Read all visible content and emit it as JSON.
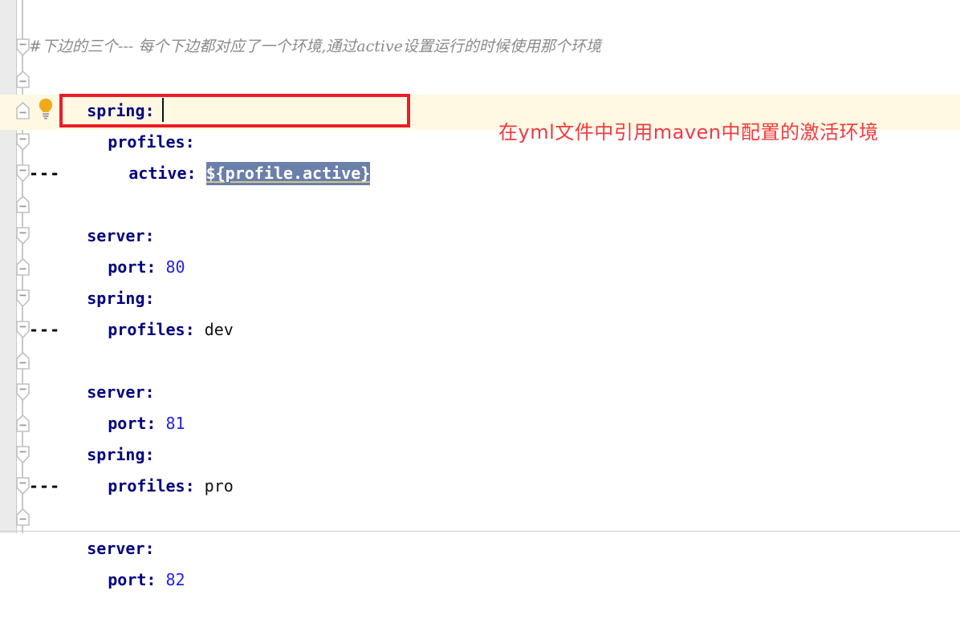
{
  "editor": {
    "app": "intellij-yaml-editor",
    "comment_line": "#下边的三个--- 每个下边都对应了一个环境,通过active设置运行的时候使用那个环境",
    "selection_background": "#6b7fab",
    "current_line_background": "#fff8e3",
    "key_color": "#000080",
    "number_color": "#2222ee",
    "comment_color": "#8a8a8a",
    "annotation_color": "#f23b3b",
    "red_box_color": "#ed1c24",
    "gutter_color": "#ebebeb"
  },
  "code": {
    "lines": [
      {
        "indent": 0,
        "key": "spring",
        "colon": ":",
        "value": "",
        "type": "key"
      },
      {
        "indent": 1,
        "key": "profiles",
        "colon": ":",
        "value": "",
        "type": "key"
      },
      {
        "indent": 2,
        "key": "active",
        "colon": ":",
        "value": "${profile.active}",
        "type": "selected"
      },
      {
        "indent": 0,
        "key": "",
        "colon": "",
        "value": "---",
        "type": "separator"
      },
      {
        "indent": 0,
        "key": "server",
        "colon": ":",
        "value": "",
        "type": "key"
      },
      {
        "indent": 1,
        "key": "port",
        "colon": ":",
        "value": "80",
        "type": "number"
      },
      {
        "indent": 0,
        "key": "spring",
        "colon": ":",
        "value": "",
        "type": "key"
      },
      {
        "indent": 1,
        "key": "profiles",
        "colon": ":",
        "value": "dev",
        "type": "string"
      },
      {
        "indent": 0,
        "key": "",
        "colon": "",
        "value": "---",
        "type": "separator"
      },
      {
        "indent": 0,
        "key": "server",
        "colon": ":",
        "value": "",
        "type": "key"
      },
      {
        "indent": 1,
        "key": "port",
        "colon": ":",
        "value": "81",
        "type": "number"
      },
      {
        "indent": 0,
        "key": "spring",
        "colon": ":",
        "value": "",
        "type": "key"
      },
      {
        "indent": 1,
        "key": "profiles",
        "colon": ":",
        "value": "pro",
        "type": "string"
      },
      {
        "indent": 0,
        "key": "",
        "colon": "",
        "value": "---",
        "type": "separator"
      },
      {
        "indent": 0,
        "key": "server",
        "colon": ":",
        "value": "",
        "type": "key"
      },
      {
        "indent": 1,
        "key": "port",
        "colon": ":",
        "value": "82",
        "type": "number"
      }
    ]
  },
  "annotation": {
    "text": "在yml文件中引用maven中配置的激活环境"
  },
  "gutter": {
    "bulb_icon": "lightbulb-icon",
    "fold_icon": "fold-collapse-icon"
  }
}
